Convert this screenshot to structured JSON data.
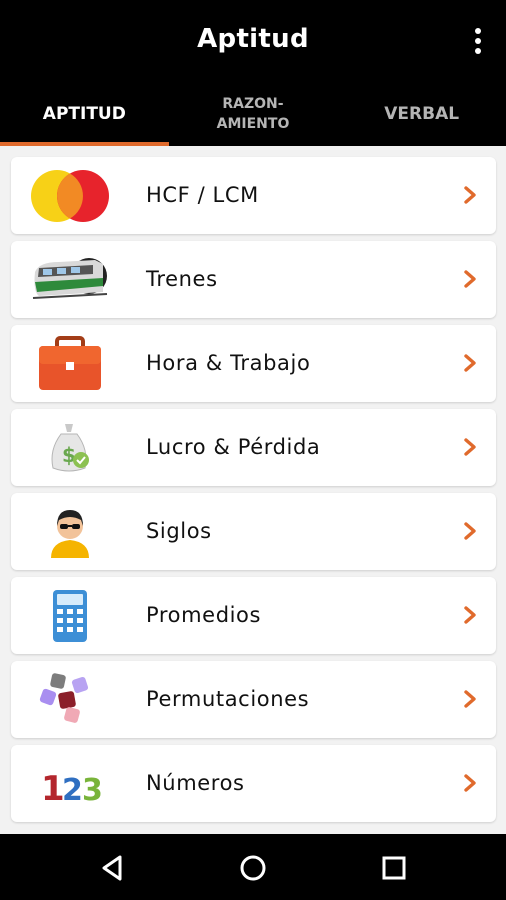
{
  "app": {
    "title": "Aptitud"
  },
  "tabs": [
    {
      "label": "APTITUD",
      "active": true
    },
    {
      "label": "RAZON-\nAMIENTO",
      "active": false
    },
    {
      "label": "VERBAL",
      "active": false
    }
  ],
  "items": [
    {
      "label": "HCF / LCM",
      "icon": "overlapping-circles-icon"
    },
    {
      "label": "Trenes",
      "icon": "train-icon"
    },
    {
      "label": "Hora & Trabajo",
      "icon": "briefcase-icon"
    },
    {
      "label": "Lucro & Pérdida",
      "icon": "money-bag-icon"
    },
    {
      "label": "Siglos",
      "icon": "person-sunglasses-icon"
    },
    {
      "label": "Promedios",
      "icon": "calculator-icon"
    },
    {
      "label": "Permutaciones",
      "icon": "puzzle-pieces-icon"
    },
    {
      "label": "Números",
      "icon": "numbers-123-icon"
    }
  ],
  "colors": {
    "accent": "#e06a2c",
    "chevron": "#e06a2c",
    "background": "#f2f2f2"
  },
  "nav": {
    "buttons": [
      "back-icon",
      "home-icon",
      "recents-icon"
    ]
  }
}
